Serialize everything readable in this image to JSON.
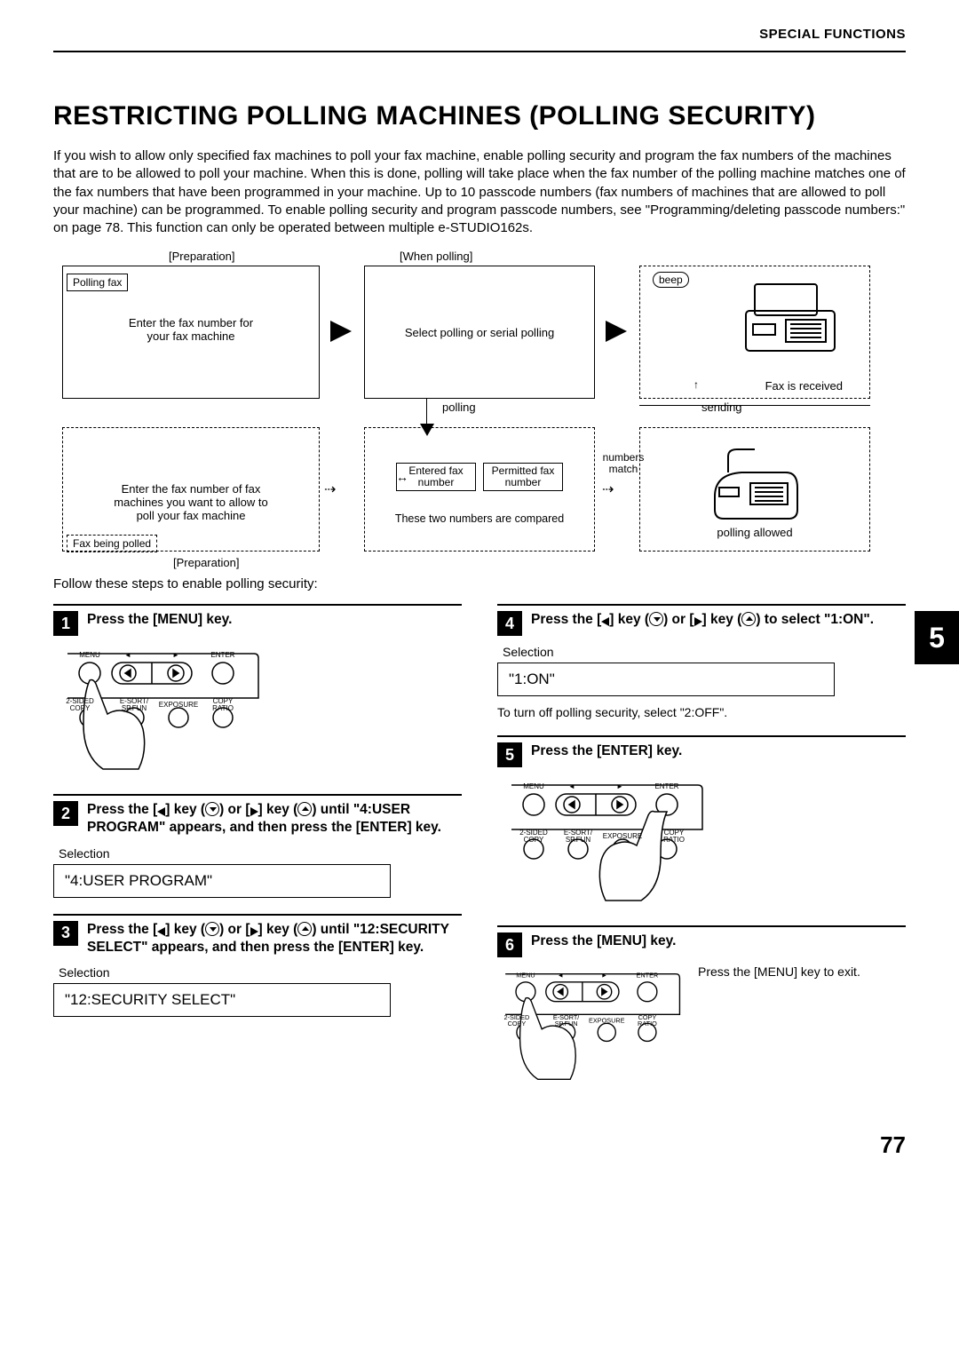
{
  "header": {
    "section": "SPECIAL FUNCTIONS"
  },
  "title": "RESTRICTING POLLING MACHINES (POLLING SECURITY)",
  "intro": "If you wish to allow only specified fax machines to poll your fax machine, enable polling security and program the fax numbers of the machines that are to be allowed to poll your machine. When this is done, polling will take place when the fax number of the polling machine matches one of the fax numbers that have been programmed in your machine. Up to 10 passcode numbers (fax numbers of machines that are allowed to poll your machine) can be programmed. To enable polling security and program passcode numbers, see \"Programming/deleting passcode numbers:\" on page 78. This function can only be operated between multiple e-STUDIO162s.",
  "flow": {
    "prep_top": "[Preparation]",
    "when_polling": "[When polling]",
    "polling_fax": "Polling fax",
    "enter_your_fax": "Enter the fax number for your fax machine",
    "select_polling": "Select polling or serial polling",
    "beep": "beep",
    "fax_received": "Fax is received",
    "polling": "polling",
    "sending": "sending",
    "enter_allow": "Enter the fax number of fax machines you want to allow to poll your fax machine",
    "entered_fax": "Entered fax number",
    "permitted_fax": "Permitted fax number",
    "numbers_match": "numbers match",
    "compared": "These two numbers are compared",
    "polling_allowed": "polling allowed",
    "fax_being_polled": "Fax being polled",
    "prep_bottom": "[Preparation]"
  },
  "follow": "Follow these steps to enable polling security:",
  "steps": {
    "s1": {
      "num": "1",
      "text": "Press the [MENU] key."
    },
    "s2": {
      "num": "2",
      "pre": "Press the [",
      "mid1": "] key (",
      "mid2": ") or [",
      "mid3": "] key (",
      "post": ") until \"4:USER PROGRAM\" appears, and then press the [ENTER] key.",
      "sel_label": "Selection",
      "sel_value": "\"4:USER PROGRAM\""
    },
    "s3": {
      "num": "3",
      "pre": "Press the [",
      "mid1": "] key (",
      "mid2": ") or [",
      "mid3": "] key (",
      "post": ") until \"12:SECURITY SELECT\" appears, and then press the [ENTER] key.",
      "sel_label": "Selection",
      "sel_value": "\"12:SECURITY SELECT\""
    },
    "s4": {
      "num": "4",
      "pre": "Press the [",
      "mid1": "] key (",
      "mid2": ") or [",
      "mid3": "] key (",
      "post": ") to select \"1:ON\".",
      "sel_label": "Selection",
      "sel_value": "\"1:ON\"",
      "note": "To turn off polling security, select \"2:OFF\"."
    },
    "s5": {
      "num": "5",
      "text": "Press the [ENTER] key."
    },
    "s6": {
      "num": "6",
      "text": "Press the [MENU] key.",
      "note": "Press the [MENU] key to exit."
    }
  },
  "panel": {
    "menu": "MENU",
    "enter": "ENTER",
    "twosided": "2-SIDED",
    "copy": "COPY",
    "esort": "E-SORT/",
    "spfun": "SP.FUN",
    "exposure": "EXPOSURE",
    "ratio": "RATIO",
    "copy2": "COPY"
  },
  "side_tab": "5",
  "page_number": "77"
}
